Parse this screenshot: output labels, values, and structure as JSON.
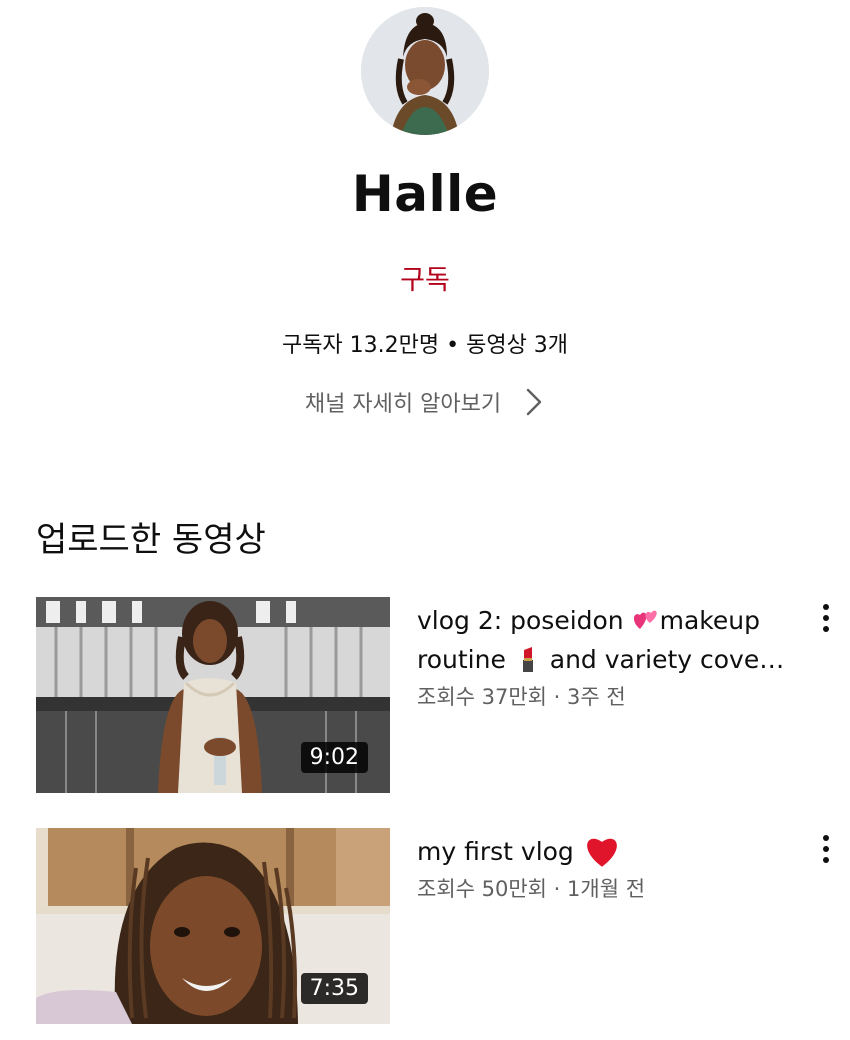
{
  "channel": {
    "name": "Halle",
    "subscribe_label": "구독",
    "stats": "구독자 13.2만명 • 동영상 3개",
    "about_label": "채널 자세히 알아보기"
  },
  "section": {
    "title": "업로드한 동영상"
  },
  "videos": [
    {
      "title_parts": [
        "vlog 2: poseidon ",
        "makeup routine ",
        "and variety cove…"
      ],
      "meta": "조회수 37만회 · 3주 전",
      "duration": "9:02"
    },
    {
      "title_parts": [
        "my first vlog "
      ],
      "meta": "조회수 50만회 · 1개월 전",
      "duration": "7:35"
    }
  ],
  "icons": {
    "about_chevron": "chevron-right-icon",
    "overflow_menu": "more-vert-icon",
    "emoji_1": "two-hearts-emoji",
    "emoji_2": "lipstick-emoji",
    "emoji_3": "red-heart-emoji"
  },
  "colors": {
    "subscribe": "#b3001b",
    "secondary_text": "#606060",
    "duration_badge": "#000000"
  }
}
